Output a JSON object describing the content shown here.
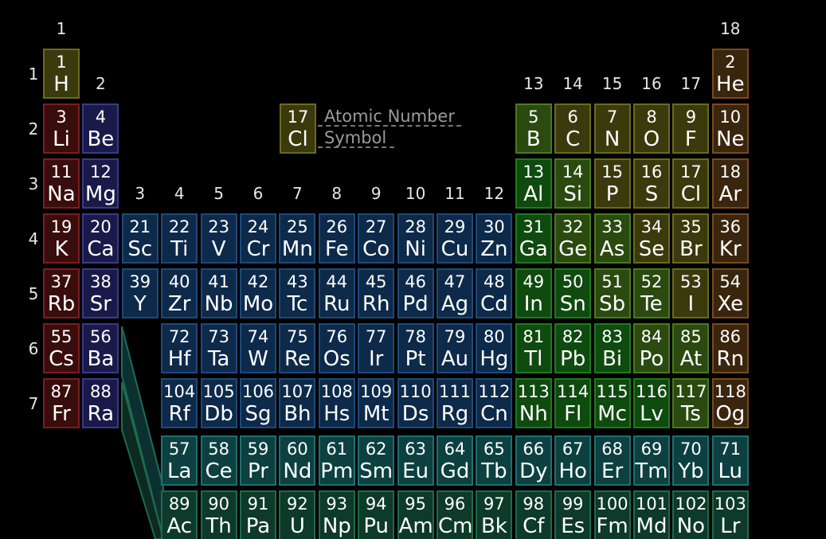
{
  "colors": {
    "alkali": {
      "bg": "#3a0d0d",
      "border": "#7a1e1e"
    },
    "alkaline": {
      "bg": "#1a1a4a",
      "border": "#3a3a8a"
    },
    "transition": {
      "bg": "#0d2a4a",
      "border": "#1d4a7a"
    },
    "post": {
      "bg": "#0f4a0f",
      "border": "#1f7a1f"
    },
    "metalloid": {
      "bg": "#2a4a0f",
      "border": "#4a7a1f"
    },
    "nonmetal": {
      "bg": "#3a3a0d",
      "border": "#6a6a1f"
    },
    "noble": {
      "bg": "#3a250d",
      "border": "#7a4a1e"
    },
    "lanthanide": {
      "bg": "#0d4040",
      "border": "#1f7070"
    },
    "actinide": {
      "bg": "#0d3a2a",
      "border": "#1f6a4a"
    }
  },
  "legend": {
    "number": "17",
    "symbol": "Cl",
    "number_label": "Atomic Number",
    "symbol_label": "Symbol"
  },
  "group_labels": [
    "1",
    "2",
    "3",
    "4",
    "5",
    "6",
    "7",
    "8",
    "9",
    "10",
    "11",
    "12",
    "13",
    "14",
    "15",
    "16",
    "17",
    "18"
  ],
  "period_labels": [
    "1",
    "2",
    "3",
    "4",
    "5",
    "6",
    "7"
  ],
  "elements": [
    [
      "1",
      "H",
      1,
      1,
      "nonmetal"
    ],
    [
      "2",
      "He",
      18,
      1,
      "noble"
    ],
    [
      "3",
      "Li",
      1,
      2,
      "alkali"
    ],
    [
      "4",
      "Be",
      2,
      2,
      "alkaline"
    ],
    [
      "5",
      "B",
      13,
      2,
      "metalloid"
    ],
    [
      "6",
      "C",
      14,
      2,
      "nonmetal"
    ],
    [
      "7",
      "N",
      15,
      2,
      "nonmetal"
    ],
    [
      "8",
      "O",
      16,
      2,
      "nonmetal"
    ],
    [
      "9",
      "F",
      17,
      2,
      "nonmetal"
    ],
    [
      "10",
      "Ne",
      18,
      2,
      "noble"
    ],
    [
      "11",
      "Na",
      1,
      3,
      "alkali"
    ],
    [
      "12",
      "Mg",
      2,
      3,
      "alkaline"
    ],
    [
      "13",
      "Al",
      13,
      3,
      "post"
    ],
    [
      "14",
      "Si",
      14,
      3,
      "metalloid"
    ],
    [
      "15",
      "P",
      15,
      3,
      "nonmetal"
    ],
    [
      "16",
      "S",
      16,
      3,
      "nonmetal"
    ],
    [
      "17",
      "Cl",
      17,
      3,
      "nonmetal"
    ],
    [
      "18",
      "Ar",
      18,
      3,
      "noble"
    ],
    [
      "19",
      "K",
      1,
      4,
      "alkali"
    ],
    [
      "20",
      "Ca",
      2,
      4,
      "alkaline"
    ],
    [
      "21",
      "Sc",
      3,
      4,
      "transition"
    ],
    [
      "22",
      "Ti",
      4,
      4,
      "transition"
    ],
    [
      "23",
      "V",
      5,
      4,
      "transition"
    ],
    [
      "24",
      "Cr",
      6,
      4,
      "transition"
    ],
    [
      "25",
      "Mn",
      7,
      4,
      "transition"
    ],
    [
      "26",
      "Fe",
      8,
      4,
      "transition"
    ],
    [
      "27",
      "Co",
      9,
      4,
      "transition"
    ],
    [
      "28",
      "Ni",
      10,
      4,
      "transition"
    ],
    [
      "29",
      "Cu",
      11,
      4,
      "transition"
    ],
    [
      "30",
      "Zn",
      12,
      4,
      "transition"
    ],
    [
      "31",
      "Ga",
      13,
      4,
      "post"
    ],
    [
      "32",
      "Ge",
      14,
      4,
      "metalloid"
    ],
    [
      "33",
      "As",
      15,
      4,
      "metalloid"
    ],
    [
      "34",
      "Se",
      16,
      4,
      "nonmetal"
    ],
    [
      "35",
      "Br",
      17,
      4,
      "nonmetal"
    ],
    [
      "36",
      "Kr",
      18,
      4,
      "noble"
    ],
    [
      "37",
      "Rb",
      1,
      5,
      "alkali"
    ],
    [
      "38",
      "Sr",
      2,
      5,
      "alkaline"
    ],
    [
      "39",
      "Y",
      3,
      5,
      "transition"
    ],
    [
      "40",
      "Zr",
      4,
      5,
      "transition"
    ],
    [
      "41",
      "Nb",
      5,
      5,
      "transition"
    ],
    [
      "42",
      "Mo",
      6,
      5,
      "transition"
    ],
    [
      "43",
      "Tc",
      7,
      5,
      "transition"
    ],
    [
      "44",
      "Ru",
      8,
      5,
      "transition"
    ],
    [
      "45",
      "Rh",
      9,
      5,
      "transition"
    ],
    [
      "46",
      "Pd",
      10,
      5,
      "transition"
    ],
    [
      "47",
      "Ag",
      11,
      5,
      "transition"
    ],
    [
      "48",
      "Cd",
      12,
      5,
      "transition"
    ],
    [
      "49",
      "In",
      13,
      5,
      "post"
    ],
    [
      "50",
      "Sn",
      14,
      5,
      "post"
    ],
    [
      "51",
      "Sb",
      15,
      5,
      "metalloid"
    ],
    [
      "52",
      "Te",
      16,
      5,
      "metalloid"
    ],
    [
      "53",
      "I",
      17,
      5,
      "nonmetal"
    ],
    [
      "54",
      "Xe",
      18,
      5,
      "noble"
    ],
    [
      "55",
      "Cs",
      1,
      6,
      "alkali"
    ],
    [
      "56",
      "Ba",
      2,
      6,
      "alkaline"
    ],
    [
      "72",
      "Hf",
      4,
      6,
      "transition"
    ],
    [
      "73",
      "Ta",
      5,
      6,
      "transition"
    ],
    [
      "74",
      "W",
      6,
      6,
      "transition"
    ],
    [
      "75",
      "Re",
      7,
      6,
      "transition"
    ],
    [
      "76",
      "Os",
      8,
      6,
      "transition"
    ],
    [
      "77",
      "Ir",
      9,
      6,
      "transition"
    ],
    [
      "78",
      "Pt",
      10,
      6,
      "transition"
    ],
    [
      "79",
      "Au",
      11,
      6,
      "transition"
    ],
    [
      "80",
      "Hg",
      12,
      6,
      "transition"
    ],
    [
      "81",
      "Tl",
      13,
      6,
      "post"
    ],
    [
      "82",
      "Pb",
      14,
      6,
      "post"
    ],
    [
      "83",
      "Bi",
      15,
      6,
      "post"
    ],
    [
      "84",
      "Po",
      16,
      6,
      "metalloid"
    ],
    [
      "85",
      "At",
      17,
      6,
      "metalloid"
    ],
    [
      "86",
      "Rn",
      18,
      6,
      "noble"
    ],
    [
      "87",
      "Fr",
      1,
      7,
      "alkali"
    ],
    [
      "88",
      "Ra",
      2,
      7,
      "alkaline"
    ],
    [
      "104",
      "Rf",
      4,
      7,
      "transition"
    ],
    [
      "105",
      "Db",
      5,
      7,
      "transition"
    ],
    [
      "106",
      "Sg",
      6,
      7,
      "transition"
    ],
    [
      "107",
      "Bh",
      7,
      7,
      "transition"
    ],
    [
      "108",
      "Hs",
      8,
      7,
      "transition"
    ],
    [
      "109",
      "Mt",
      9,
      7,
      "transition"
    ],
    [
      "110",
      "Ds",
      10,
      7,
      "transition"
    ],
    [
      "111",
      "Rg",
      11,
      7,
      "transition"
    ],
    [
      "112",
      "Cn",
      12,
      7,
      "transition"
    ],
    [
      "113",
      "Nh",
      13,
      7,
      "post"
    ],
    [
      "114",
      "Fl",
      14,
      7,
      "post"
    ],
    [
      "115",
      "Mc",
      15,
      7,
      "post"
    ],
    [
      "116",
      "Lv",
      16,
      7,
      "post"
    ],
    [
      "117",
      "Ts",
      17,
      7,
      "metalloid"
    ],
    [
      "118",
      "Og",
      18,
      7,
      "noble"
    ],
    [
      "57",
      "La",
      4,
      8,
      "lanthanide"
    ],
    [
      "58",
      "Ce",
      5,
      8,
      "lanthanide"
    ],
    [
      "59",
      "Pr",
      6,
      8,
      "lanthanide"
    ],
    [
      "60",
      "Nd",
      7,
      8,
      "lanthanide"
    ],
    [
      "61",
      "Pm",
      8,
      8,
      "lanthanide"
    ],
    [
      "62",
      "Sm",
      9,
      8,
      "lanthanide"
    ],
    [
      "63",
      "Eu",
      10,
      8,
      "lanthanide"
    ],
    [
      "64",
      "Gd",
      11,
      8,
      "lanthanide"
    ],
    [
      "65",
      "Tb",
      12,
      8,
      "lanthanide"
    ],
    [
      "66",
      "Dy",
      13,
      8,
      "lanthanide"
    ],
    [
      "67",
      "Ho",
      14,
      8,
      "lanthanide"
    ],
    [
      "68",
      "Er",
      15,
      8,
      "lanthanide"
    ],
    [
      "69",
      "Tm",
      16,
      8,
      "lanthanide"
    ],
    [
      "70",
      "Yb",
      17,
      8,
      "lanthanide"
    ],
    [
      "71",
      "Lu",
      18,
      8,
      "lanthanide"
    ],
    [
      "89",
      "Ac",
      4,
      9,
      "actinide"
    ],
    [
      "90",
      "Th",
      5,
      9,
      "actinide"
    ],
    [
      "91",
      "Pa",
      6,
      9,
      "actinide"
    ],
    [
      "92",
      "U",
      7,
      9,
      "actinide"
    ],
    [
      "93",
      "Np",
      8,
      9,
      "actinide"
    ],
    [
      "94",
      "Pu",
      9,
      9,
      "actinide"
    ],
    [
      "95",
      "Am",
      10,
      9,
      "actinide"
    ],
    [
      "96",
      "Cm",
      11,
      9,
      "actinide"
    ],
    [
      "97",
      "Bk",
      12,
      9,
      "actinide"
    ],
    [
      "98",
      "Cf",
      13,
      9,
      "actinide"
    ],
    [
      "99",
      "Es",
      14,
      9,
      "actinide"
    ],
    [
      "100",
      "Fm",
      15,
      9,
      "actinide"
    ],
    [
      "101",
      "Md",
      16,
      9,
      "actinide"
    ],
    [
      "102",
      "No",
      17,
      9,
      "actinide"
    ],
    [
      "103",
      "Lr",
      18,
      9,
      "actinide"
    ]
  ]
}
